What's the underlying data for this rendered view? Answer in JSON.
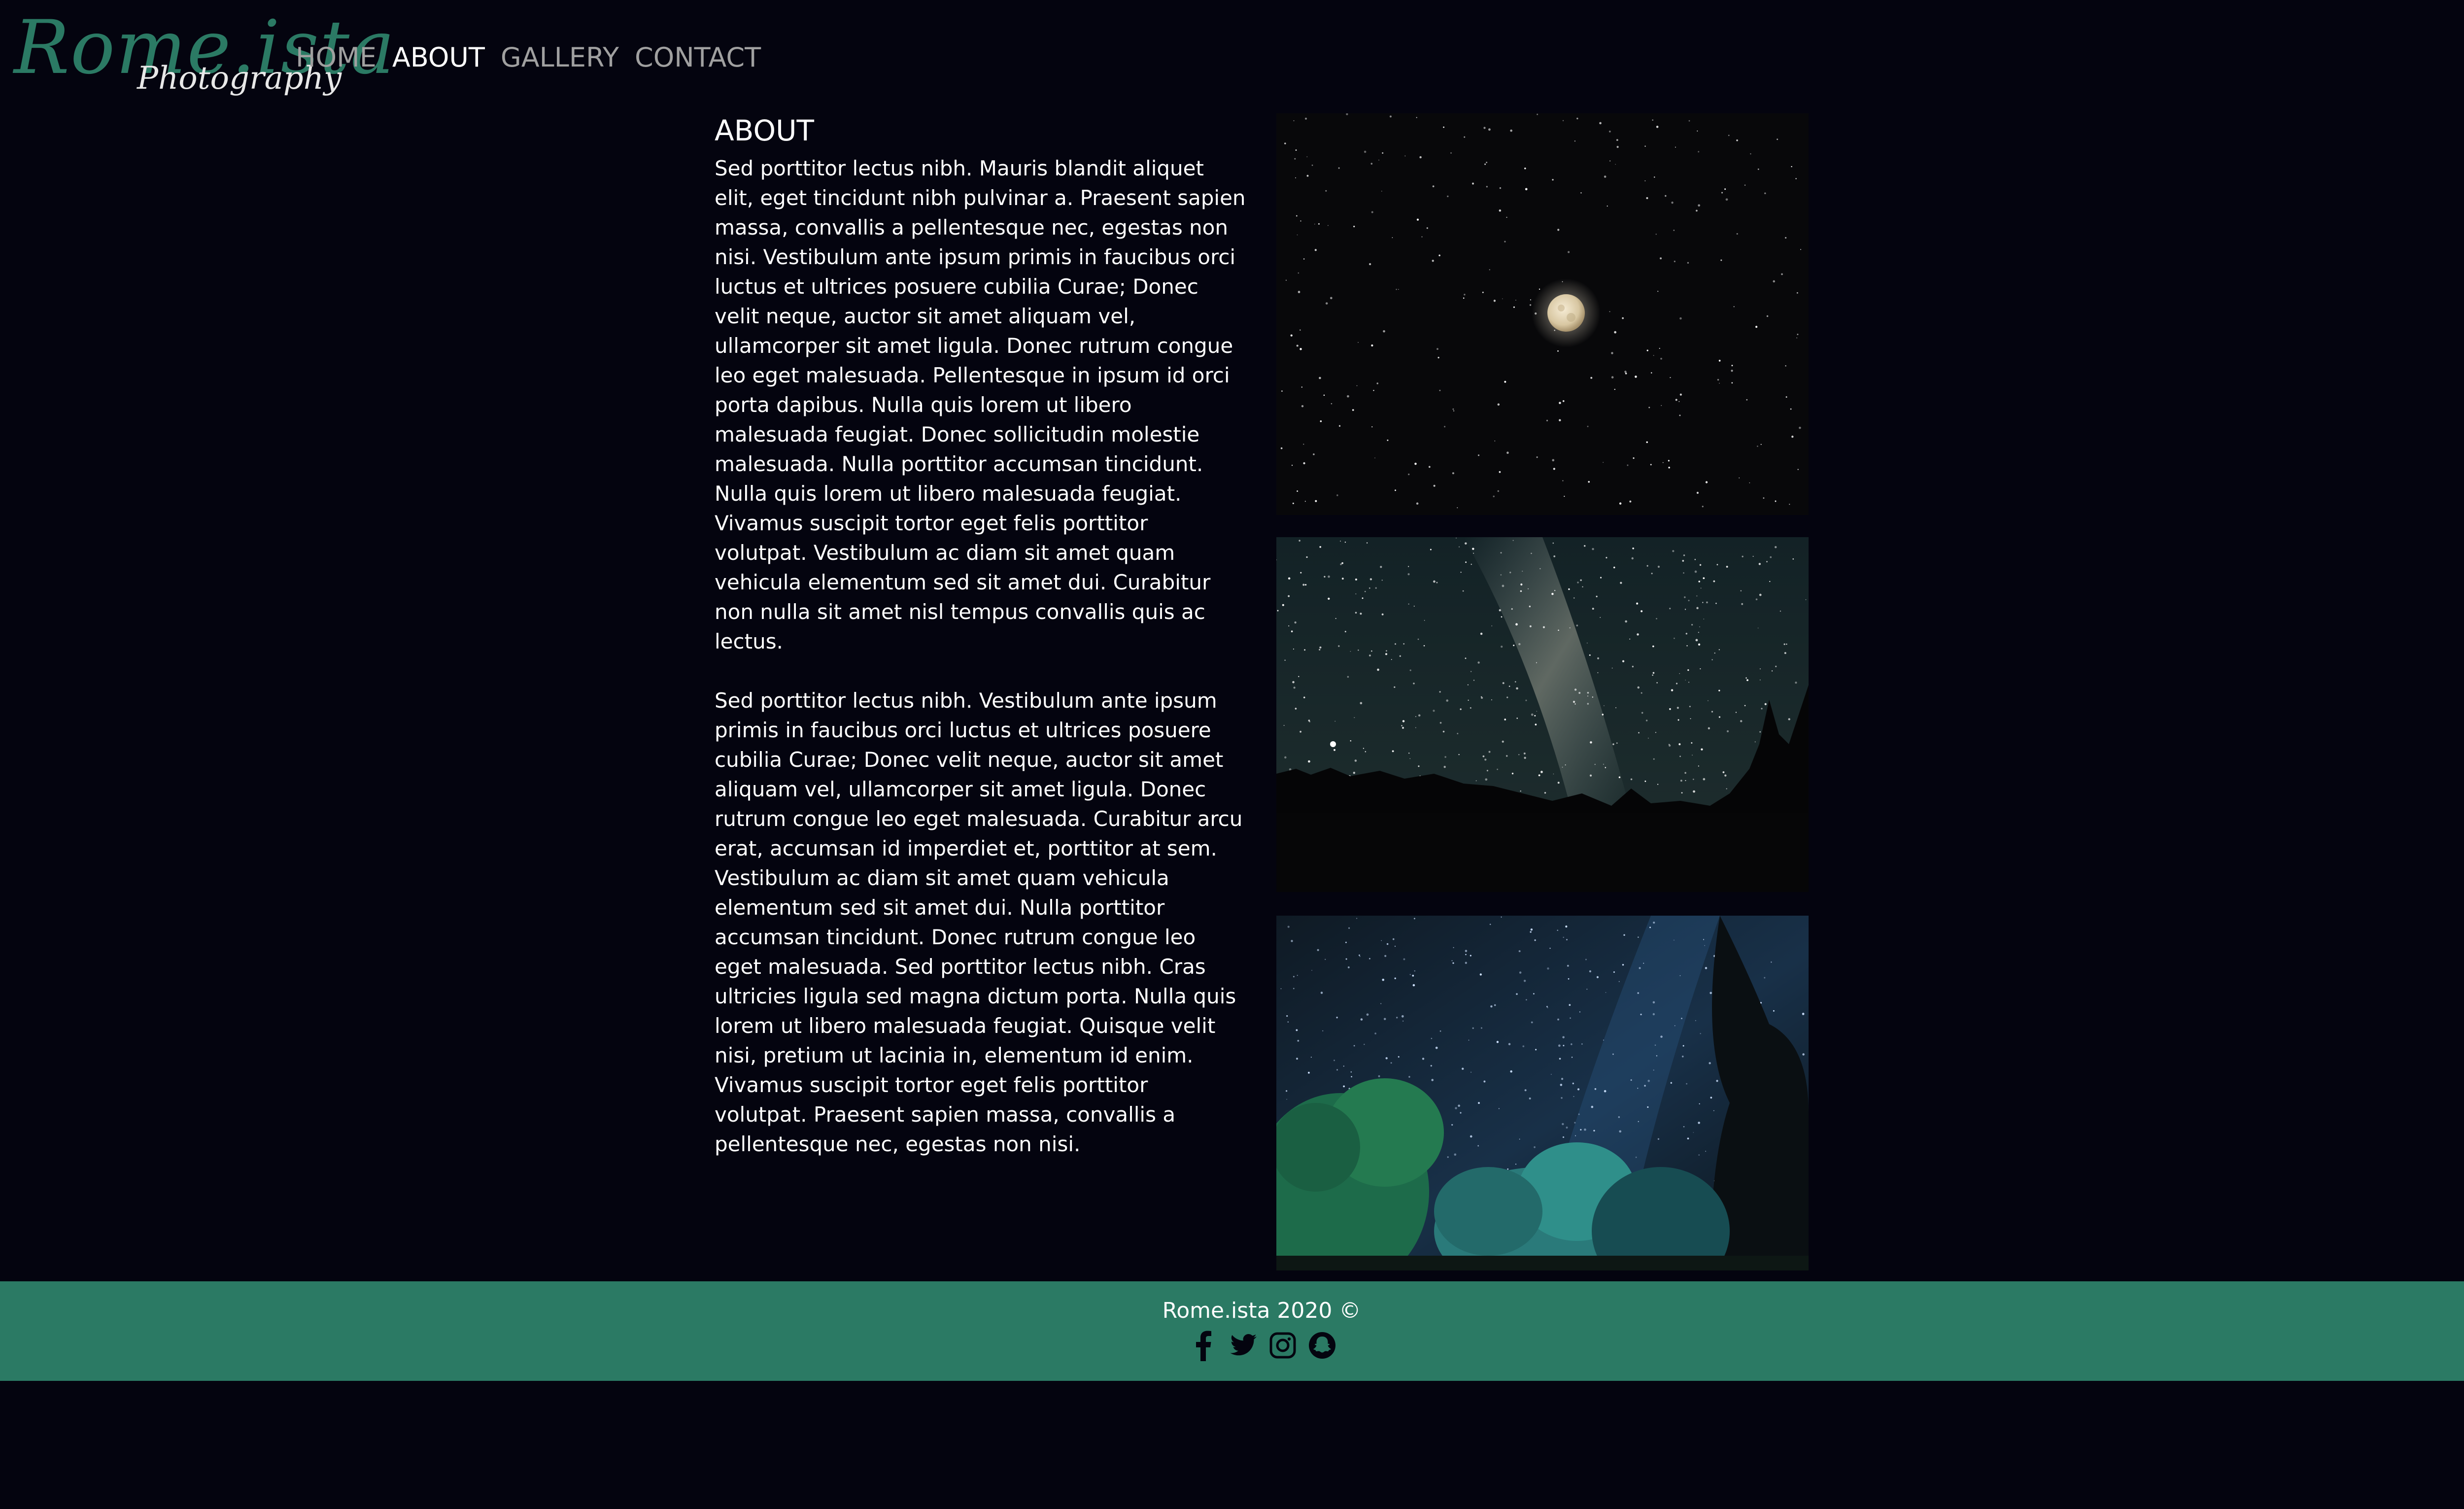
{
  "logo": {
    "brand": "Rome.ista",
    "sub": "Photography",
    "color": "#2b7a64"
  },
  "nav": {
    "items": [
      {
        "label": "HOME",
        "active": false
      },
      {
        "label": "ABOUT",
        "active": true
      },
      {
        "label": "GALLERY",
        "active": false
      },
      {
        "label": "CONTACT",
        "active": false
      }
    ]
  },
  "about": {
    "title": "ABOUT",
    "paragraphs": [
      "Sed porttitor lectus nibh. Mauris blandit aliquet elit, eget tincidunt nibh pulvinar a. Praesent sapien massa, convallis a pellentesque nec, egestas non nisi. Vestibulum ante ipsum primis in faucibus orci luctus et ultrices posuere cubilia Curae; Donec velit neque, auctor sit amet aliquam vel, ullamcorper sit amet ligula. Donec rutrum congue leo eget malesuada. Pellentesque in ipsum id orci porta dapibus. Nulla quis lorem ut libero malesuada feugiat. Donec sollicitudin molestie malesuada. Nulla porttitor accumsan tincidunt. Nulla quis lorem ut libero malesuada feugiat. Vivamus suscipit tortor eget felis porttitor volutpat. Vestibulum ac diam sit amet quam vehicula elementum sed sit amet dui. Curabitur non nulla sit amet nisl tempus convallis quis ac lectus.",
      "Sed porttitor lectus nibh. Vestibulum ante ipsum primis in faucibus orci luctus et ultrices posuere cubilia Curae; Donec velit neque, auctor sit amet aliquam vel, ullamcorper sit amet ligula. Donec rutrum congue leo eget malesuada. Curabitur arcu erat, accumsan id imperdiet et, porttitor at sem. Vestibulum ac diam sit amet quam vehicula elementum sed sit amet dui. Nulla porttitor accumsan tincidunt. Donec rutrum congue leo eget malesuada. Sed porttitor lectus nibh. Cras ultricies ligula sed magna dictum porta. Nulla quis lorem ut libero malesuada feugiat. Quisque velit nisi, pretium ut lacinia in, elementum id enim. Vivamus suscipit tortor eget felis porttitor volutpat. Praesent sapien massa, convallis a pellentesque nec, egestas non nisi."
    ]
  },
  "gallery": {
    "photos": [
      {
        "subject": "full moon in starry sky"
      },
      {
        "subject": "milky way over tree line"
      },
      {
        "subject": "starry sky over green trees"
      }
    ]
  },
  "footer": {
    "copyright": "Rome.ista 2020 ©",
    "background": "#2b7a64",
    "social_icons": [
      "facebook-icon",
      "twitter-icon",
      "instagram-icon",
      "snapchat-icon"
    ]
  }
}
